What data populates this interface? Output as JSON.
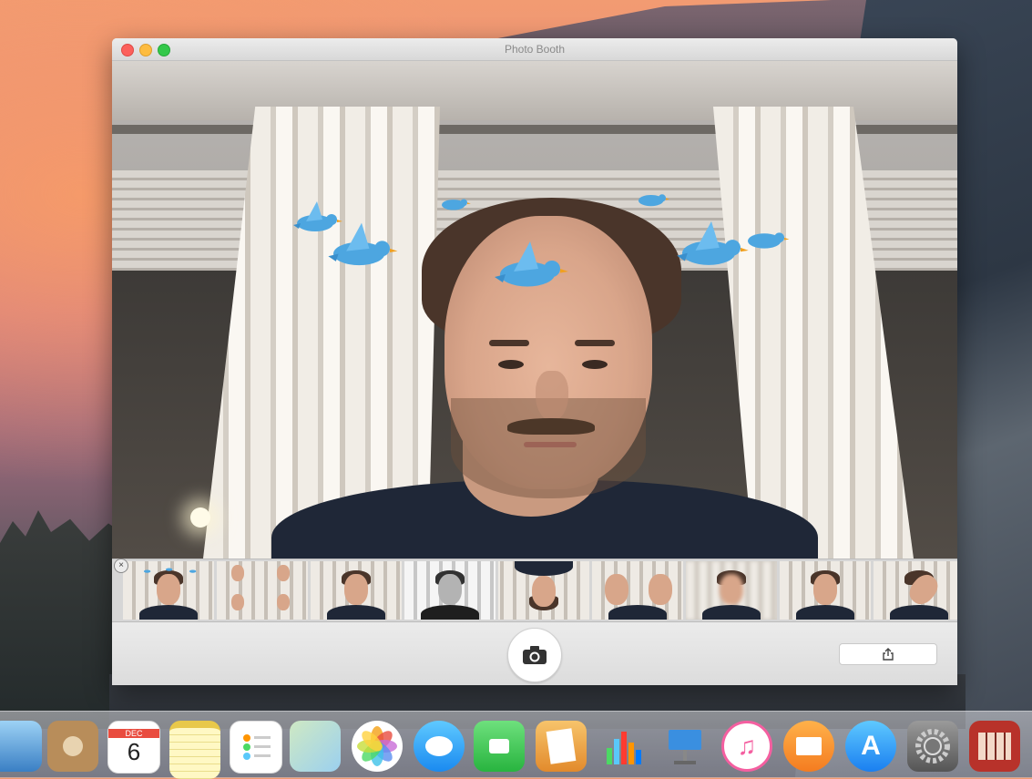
{
  "window": {
    "title": "Photo Booth"
  },
  "camera": {
    "effect": "Birdies"
  },
  "filmstrip": {
    "thumbnails": [
      {
        "effect": "birdies",
        "selected": true
      },
      {
        "effect": "quad",
        "selected": false
      },
      {
        "effect": "normal",
        "selected": false
      },
      {
        "effect": "black-and-white",
        "selected": false
      },
      {
        "effect": "upside-down",
        "selected": false
      },
      {
        "effect": "mirror",
        "selected": false
      },
      {
        "effect": "blur",
        "selected": false
      },
      {
        "effect": "normal",
        "selected": false
      },
      {
        "effect": "twirl",
        "selected": false
      }
    ]
  },
  "toolbar": {
    "shutter_icon": "camera-icon",
    "share_icon": "share-icon"
  },
  "dock": {
    "calendar_month": "DEC",
    "calendar_day": "6",
    "apps": [
      "Preview",
      "Contacts",
      "Calendar",
      "Notes",
      "Reminders",
      "Maps",
      "Photos",
      "Messages",
      "FaceTime",
      "Pages",
      "Numbers",
      "Keynote",
      "iTunes",
      "iBooks",
      "App Store",
      "System Preferences",
      "Photo Booth"
    ]
  },
  "colors": {
    "close": "#fc605c",
    "minimize": "#fdbc40",
    "zoom": "#34c84a",
    "selection": "#7fb0e6",
    "bird": "#4da6e0"
  }
}
